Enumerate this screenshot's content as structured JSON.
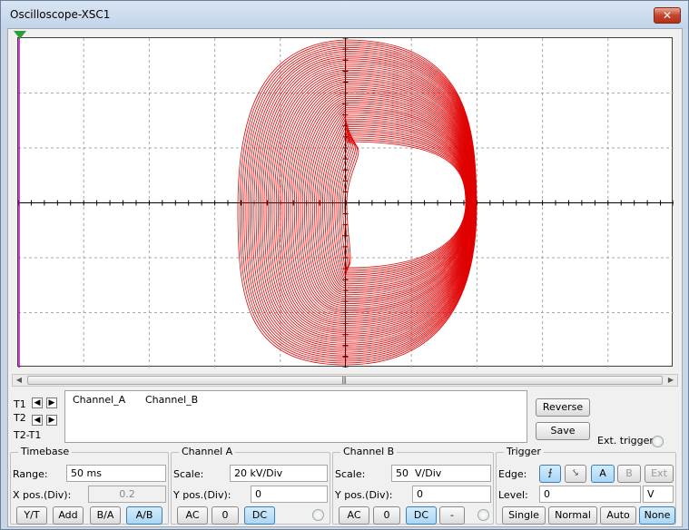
{
  "window": {
    "title": "Oscilloscope-XSC1",
    "close_label": "✕"
  },
  "scrollbar": {
    "grip": "|||"
  },
  "cursors": {
    "t1_label": "T1",
    "t2_label": "T2",
    "t2t1_label": "T2-T1",
    "columns": [
      "Channel_A",
      "Channel_B"
    ]
  },
  "side_buttons": {
    "reverse": "Reverse",
    "save": "Save",
    "ext_trigger": "Ext. trigger"
  },
  "timebase": {
    "title": "Timebase",
    "range_label": "Range:",
    "range_value": "50 ms",
    "xpos_label": "X pos.(Div):",
    "xpos_value": "0.2",
    "modes": [
      "Y/T",
      "Add",
      "B/A",
      "A/B"
    ],
    "active_mode": "A/B"
  },
  "channel_a": {
    "title": "Channel A",
    "scale_label": "Scale:",
    "scale_value": "20 kV/Div",
    "ypos_label": "Y pos.(Div):",
    "ypos_value": "0",
    "coupling": [
      "AC",
      "0",
      "DC"
    ],
    "active_coupling": "DC"
  },
  "channel_b": {
    "title": "Channel B",
    "scale_label": "Scale:",
    "scale_value": "50  V/Div",
    "ypos_label": "Y pos.(Div):",
    "ypos_value": "0",
    "coupling": [
      "AC",
      "0",
      "DC",
      "-"
    ],
    "active_coupling": "DC"
  },
  "trigger": {
    "title": "Trigger",
    "edge_label": "Edge:",
    "sources": [
      "A",
      "B",
      "Ext"
    ],
    "active_source": "A",
    "level_label": "Level:",
    "level_value": "0",
    "level_unit": "V",
    "modes": [
      "Single",
      "Normal",
      "Auto",
      "None"
    ],
    "active_mode": "None"
  },
  "colors": {
    "trace": "#e00000",
    "accent": "#a9d6f5"
  }
}
